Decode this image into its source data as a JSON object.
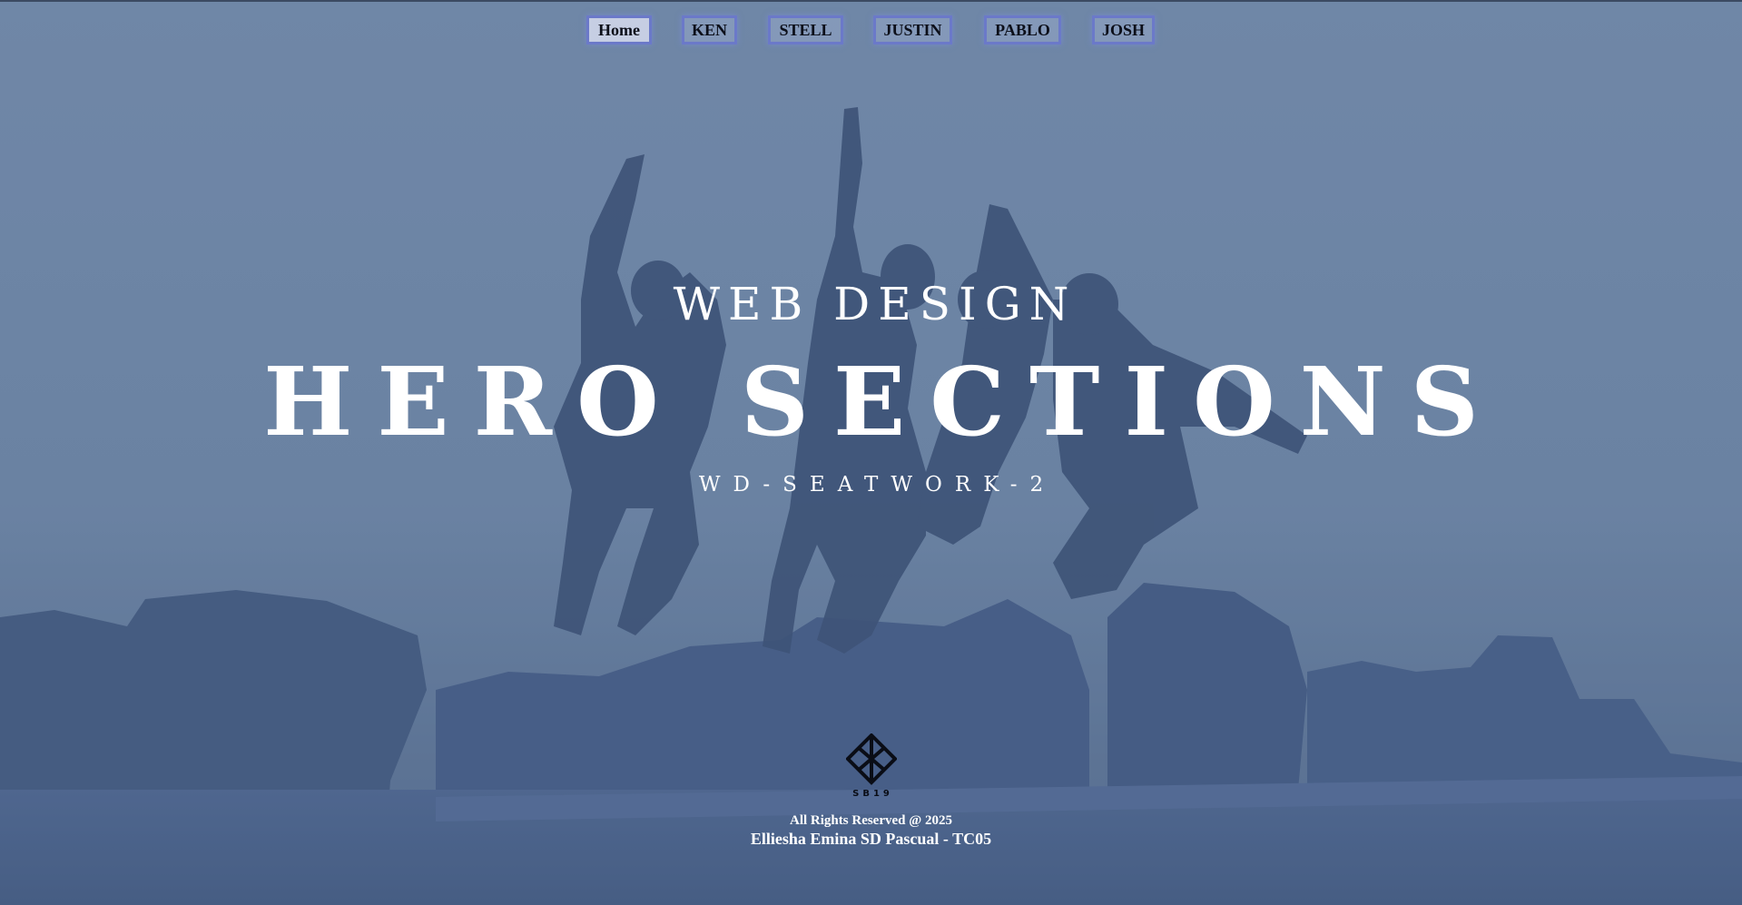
{
  "nav": {
    "items": [
      {
        "label": "Home",
        "active": true
      },
      {
        "label": "KEN",
        "active": false
      },
      {
        "label": "STELL",
        "active": false
      },
      {
        "label": "JUSTIN",
        "active": false
      },
      {
        "label": "PABLO",
        "active": false
      },
      {
        "label": "JOSH",
        "active": false
      }
    ]
  },
  "hero": {
    "eyebrow": "WEB DESIGN",
    "title": "HERO SECTIONS",
    "subtitle": "WD-SEATWORK-2"
  },
  "footer": {
    "logo_text": "SB19",
    "rights": "All Rights Reserved @ 2025",
    "author": "Elliesha Emina SD Pascual - TC05"
  },
  "colors": {
    "overlay": "#6f86a6",
    "text": "#ffffff",
    "nav_border": "#6b79c9",
    "logo": "#0a0d16"
  }
}
